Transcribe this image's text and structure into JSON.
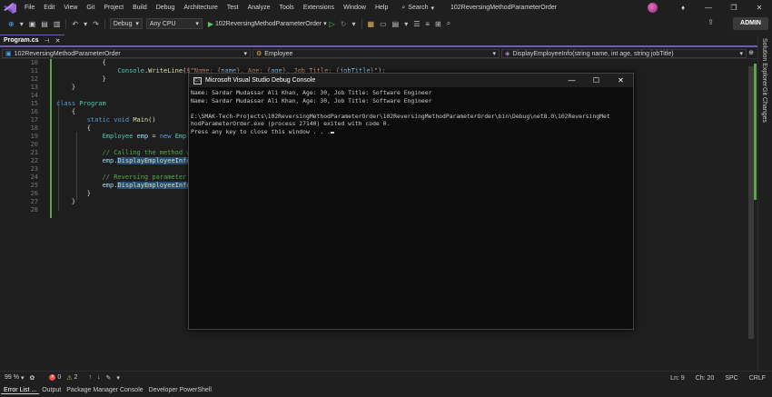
{
  "menu": {
    "items": [
      "File",
      "Edit",
      "View",
      "Git",
      "Project",
      "Build",
      "Debug",
      "Architecture",
      "Test",
      "Analyze",
      "Tools",
      "Extensions",
      "Window",
      "Help"
    ],
    "search_label": "Search",
    "solution_name": "102ReversingMethodParameterOrder"
  },
  "window_controls": {
    "minimize": "—",
    "restore": "❐",
    "close": "✕"
  },
  "toolbar": {
    "config": "Debug",
    "platform": "Any CPU",
    "startup_project": "102ReversingMethodParameterOrder",
    "admin_label": "ADMIN"
  },
  "tabs": [
    {
      "label": "Program.cs",
      "active": true
    }
  ],
  "navbar": {
    "project": "102ReversingMethodParameterOrder",
    "class": "Employee",
    "member": "DisplayEmployeeInfo(string name, int age, string jobTitle)"
  },
  "code_lines": [
    {
      "num": "10",
      "indent": "            ",
      "tokens": [
        {
          "t": "{",
          "c": "txt"
        }
      ]
    },
    {
      "num": "11",
      "indent": "                ",
      "tokens": [
        {
          "t": "Console",
          "c": "cls"
        },
        {
          "t": ".",
          "c": "txt"
        },
        {
          "t": "WriteLine",
          "c": "fn"
        },
        {
          "t": "(",
          "c": "txt"
        },
        {
          "t": "$\"Name: {",
          "c": "str"
        },
        {
          "t": "name",
          "c": "var"
        },
        {
          "t": "}, Age: {",
          "c": "str"
        },
        {
          "t": "age",
          "c": "var"
        },
        {
          "t": "}, Job Title: {",
          "c": "str"
        },
        {
          "t": "jobTitle",
          "c": "var"
        },
        {
          "t": "}\"",
          "c": "str"
        },
        {
          "t": ");",
          "c": "txt"
        }
      ]
    },
    {
      "num": "12",
      "indent": "            ",
      "tokens": [
        {
          "t": "}",
          "c": "txt"
        }
      ]
    },
    {
      "num": "13",
      "indent": "    ",
      "tokens": [
        {
          "t": "}",
          "c": "txt"
        }
      ]
    },
    {
      "num": "14",
      "indent": "",
      "tokens": []
    },
    {
      "num": "15",
      "indent": "",
      "tokens": [
        {
          "t": "class ",
          "c": "kw"
        },
        {
          "t": "Program",
          "c": "cls"
        }
      ]
    },
    {
      "num": "16",
      "indent": "    ",
      "tokens": [
        {
          "t": "{",
          "c": "txt"
        }
      ]
    },
    {
      "num": "17",
      "indent": "        ",
      "tokens": [
        {
          "t": "static ",
          "c": "kw"
        },
        {
          "t": "void ",
          "c": "kw"
        },
        {
          "t": "Main",
          "c": "fn"
        },
        {
          "t": "()",
          "c": "txt"
        }
      ]
    },
    {
      "num": "18",
      "indent": "        ",
      "tokens": [
        {
          "t": "{",
          "c": "txt"
        }
      ]
    },
    {
      "num": "19",
      "indent": "            ",
      "tokens": [
        {
          "t": "Employee ",
          "c": "cls"
        },
        {
          "t": "emp",
          "c": "var"
        },
        {
          "t": " = ",
          "c": "txt"
        },
        {
          "t": "new ",
          "c": "kw"
        },
        {
          "t": "Employee",
          "c": "cls"
        }
      ]
    },
    {
      "num": "20",
      "indent": "",
      "tokens": []
    },
    {
      "num": "21",
      "indent": "            ",
      "tokens": [
        {
          "t": "// Calling the method with",
          "c": "cmt"
        }
      ]
    },
    {
      "num": "22",
      "indent": "            ",
      "tokens": [
        {
          "t": "emp",
          "c": "var"
        },
        {
          "t": ".",
          "c": "txt"
        },
        {
          "t": "DisplayEmployeeInfo",
          "c": "fn hl"
        },
        {
          "t": "(",
          "c": "txt"
        },
        {
          "t": "\"Sa",
          "c": "str"
        }
      ]
    },
    {
      "num": "23",
      "indent": "",
      "tokens": []
    },
    {
      "num": "24",
      "indent": "            ",
      "tokens": [
        {
          "t": "// Reversing parameter orde",
          "c": "cmt"
        }
      ]
    },
    {
      "num": "25",
      "indent": "            ",
      "tokens": [
        {
          "t": "emp",
          "c": "var"
        },
        {
          "t": ".",
          "c": "txt"
        },
        {
          "t": "DisplayEmployeeInfo",
          "c": "fn hl"
        },
        {
          "t": "(",
          "c": "txt"
        },
        {
          "t": "age",
          "c": "var"
        }
      ]
    },
    {
      "num": "26",
      "indent": "        ",
      "tokens": [
        {
          "t": "}",
          "c": "txt"
        }
      ]
    },
    {
      "num": "27",
      "indent": "    ",
      "tokens": [
        {
          "t": "}",
          "c": "txt"
        }
      ]
    },
    {
      "num": "28",
      "indent": "",
      "tokens": []
    }
  ],
  "console": {
    "title": "Microsoft Visual Studio Debug Console",
    "icon_text": "C:\\",
    "lines": [
      "Name: Sardar Mudassar Ali Khan, Age: 30, Job Title: Software Engineer",
      "Name: Sardar Mudassar Ali Khan, Age: 30, Job Title: Software Engineer",
      "",
      "E:\\SMAK-Tech-Projects\\102ReversingMethodParameterOrder\\102ReversingMethodParameterOrder\\bin\\Debug\\net8.0\\102ReversingMet",
      "hodParameterOrder.exe (process 27140) exited with code 0.",
      "Press any key to close this window . . ."
    ]
  },
  "side_panels": [
    "Solution Explorer",
    "Git Changes"
  ],
  "editor_status": {
    "zoom": "99 %",
    "errors": "0",
    "warnings": "2",
    "line": "Ln: 9",
    "col": "Ch: 20",
    "spc": "SPC",
    "crlf": "CRLF"
  },
  "bottom_tabs": [
    "Error List ...",
    "Output",
    "Package Manager Console",
    "Developer PowerShell"
  ]
}
